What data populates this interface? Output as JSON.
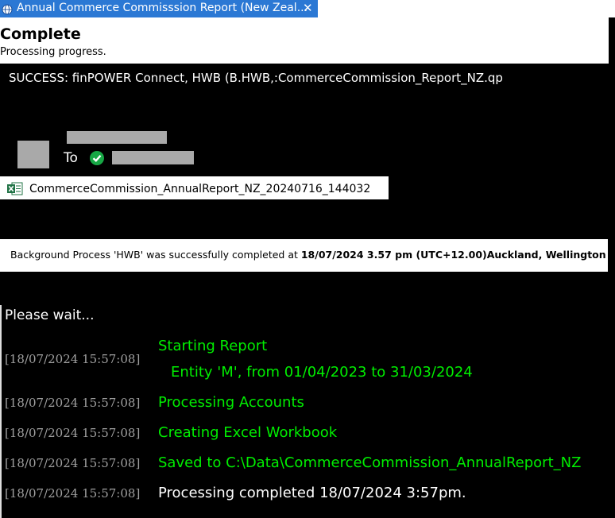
{
  "tab": {
    "title": "Annual Commerce Commisssion Report (New Zeal...",
    "close": "✕",
    "icon": "globe-icon"
  },
  "header": {
    "title": "Complete",
    "subtitle": "Processing progress."
  },
  "email": {
    "subject": "SUCCESS: finPOWER Connect, HWB (B.HWB,:CommerceCommission_Report_NZ.qp",
    "to_label": "To",
    "attachment": "CommerceCommission_AnnualReport_NZ_20240716_144032"
  },
  "notice": {
    "prefix": "Background Process 'HWB' was successfully completed at ",
    "when": "18/07/2024 3.57 pm (UTC+12.00)Auckland, Wellington"
  },
  "log": {
    "wait": "Please wait...",
    "entries": [
      {
        "time": "[18/07/2024 15:57:08]",
        "text": "Starting Report",
        "detail": "Entity 'M', from 01/04/2023 to 31/03/2024"
      },
      {
        "time": "[18/07/2024 15:57:08]",
        "text": "Processing Accounts"
      },
      {
        "time": "[18/07/2024 15:57:08]",
        "text": "Creating Excel Workbook"
      },
      {
        "time": "[18/07/2024 15:57:08]",
        "text": "Saved to C:\\Data\\CommerceCommission_AnnualReport_NZ"
      },
      {
        "time": "[18/07/2024 15:57:08]",
        "text": "Processing completed 18/07/2024 3:57pm."
      }
    ]
  },
  "colors": {
    "tab": "#2b78d4",
    "log_text": "#00ee00",
    "timestamp": "#a0a0a0"
  }
}
